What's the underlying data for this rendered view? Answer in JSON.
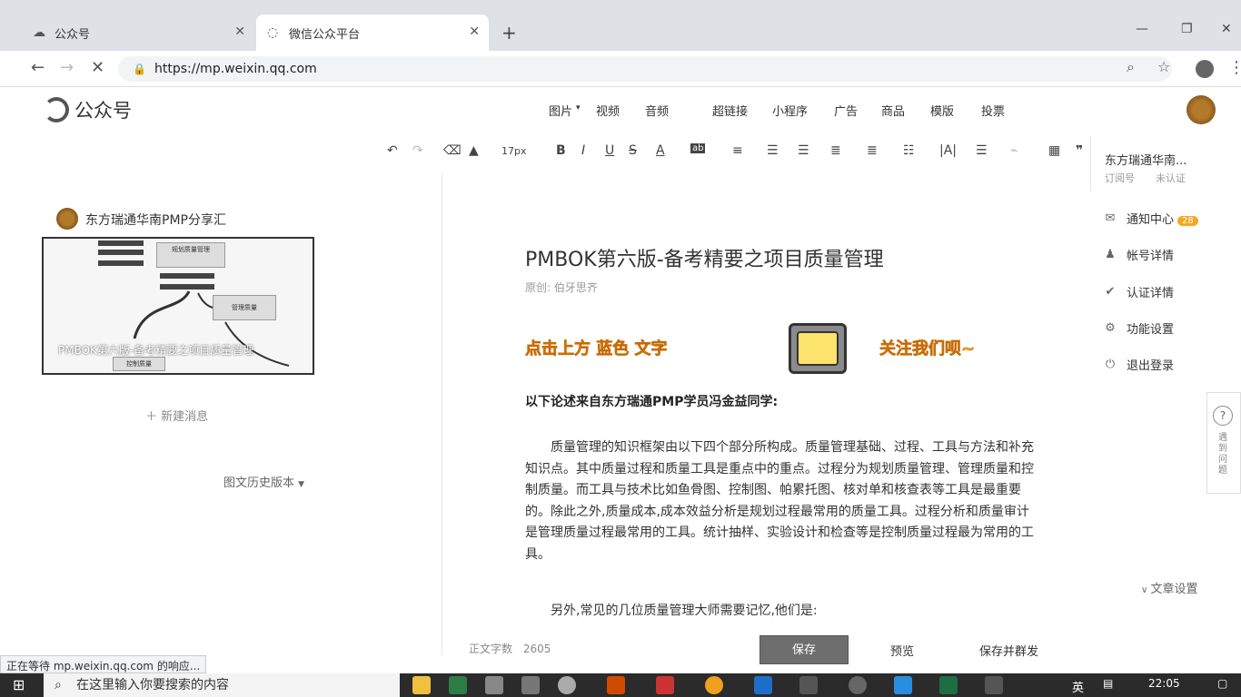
{
  "browser": {
    "tabs": [
      {
        "title": "公众号",
        "icon": "cloud-icon"
      },
      {
        "title": "微信公众平台",
        "icon": "loading-icon"
      }
    ],
    "url": "https://mp.weixin.qq.com",
    "status_text": "正在等待 mp.weixin.qq.com 的响应..."
  },
  "app": {
    "logo_text": "公众号",
    "menu": [
      "图片",
      "视频",
      "音频",
      "超链接",
      "小程序",
      "广告",
      "商品",
      "模版",
      "投票"
    ]
  },
  "toolbar": {
    "font_size": "17px"
  },
  "left": {
    "account_name": "东方瑞通华南PMP分享汇",
    "thumbnail_title": "PMBOK第六版-备考精要之项目质量管理",
    "thumbnail_nodes": [
      "规划质量管理",
      "管理质量",
      "控制质量"
    ],
    "new_message": "新建消息",
    "history_version": "图文历史版本"
  },
  "article": {
    "title": "PMBOK第六版-备考精要之项目质量管理",
    "meta_label": "原创:",
    "author": "伯牙思齐",
    "banner_left": "点击上方 蓝色 文字",
    "banner_right": "关注我们呗~",
    "lead": "以下论述来自东方瑞通PMP学员冯金益同学:",
    "paragraph1": "质量管理的知识框架由以下四个部分所构成。质量管理基础、过程、工具与方法和补充知识点。其中质量过程和质量工具是重点中的重点。过程分为规划质量管理、管理质量和控制质量。而工具与技术比如鱼骨图、控制图、帕累托图、核对单和核查表等工具是最重要的。除此之外,质量成本,成本效益分析是规划过程最常用的质量工具。过程分析和质量审计是管理质量过程最常用的工具。统计抽样、实验设计和检查等是控制质量过程最为常用的工具。",
    "paragraph2": "另外,常见的几位质量管理大师需要记忆,他们是:"
  },
  "bottom": {
    "word_count_label": "正文字数",
    "word_count": "2605",
    "save": "保存",
    "preview": "预览",
    "publish": "保存并群发"
  },
  "right_panel": {
    "account_short": "东方瑞通华南...",
    "sub1": "订阅号",
    "sub2": "未认证",
    "items": [
      {
        "label": "通知中心",
        "icon": "mail-icon",
        "badge": "28"
      },
      {
        "label": "帐号详情",
        "icon": "user-icon"
      },
      {
        "label": "认证详情",
        "icon": "verified-icon"
      },
      {
        "label": "功能设置",
        "icon": "gear-icon"
      },
      {
        "label": "退出登录",
        "icon": "power-icon"
      }
    ],
    "feedback": "遇到问题",
    "article_settings": "文章设置"
  },
  "taskbar": {
    "search_placeholder": "在这里输入你要搜索的内容",
    "ime": "英",
    "time": "22:05"
  },
  "colors": {
    "accent": "#f5a623",
    "save_button": "#6e6e6e"
  }
}
